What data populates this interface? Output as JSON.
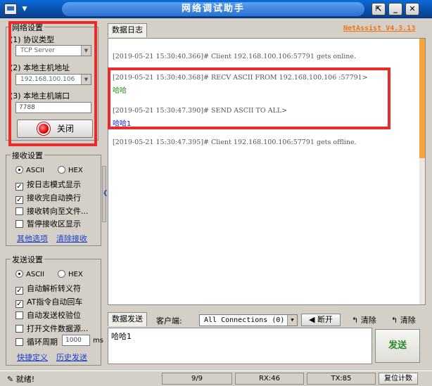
{
  "window": {
    "title": "网络调试助手",
    "brand": "NetAssist V4.3.13"
  },
  "net_settings": {
    "title": "网络设置",
    "protocol_label": "(1) 协议类型",
    "protocol_value": "TCP Server",
    "host_label": "(2) 本地主机地址",
    "host_value": "192.168.100.106",
    "port_label": "(3) 本地主机端口",
    "port_value": "7788",
    "close_label": "关闭"
  },
  "recv_settings": {
    "title": "接收设置",
    "radio_ascii": "ASCII",
    "radio_hex": "HEX",
    "options": [
      "按日志模式显示",
      "接收完自动换行",
      "接收转向至文件...",
      "暂停接收区显示"
    ],
    "checked": [
      true,
      true,
      false,
      false
    ],
    "link_more": "其他选项",
    "link_clear": "清除接收"
  },
  "send_settings": {
    "title": "发送设置",
    "radio_ascii": "ASCII",
    "radio_hex": "HEX",
    "options": [
      "自动解析转义符",
      "AT指令自动回车",
      "自动发送校验位",
      "打开文件数据源..."
    ],
    "checked": [
      true,
      true,
      false,
      false
    ],
    "loop_label": "循环周期",
    "loop_value": "1000",
    "loop_unit": "ms",
    "link_shortcut": "快捷定义",
    "link_history": "历史发送"
  },
  "log": {
    "tab": "数据日志",
    "lines": [
      "[2019-05-21 15:30:40.366]# Client 192.168.100.106:57791 gets online.",
      "[2019-05-21 15:30:40.368]# RECV ASCII FROM 192.168.100.106 :57791>",
      "哈哈",
      "[2019-05-21 15:30:47.390]# SEND ASCII TO ALL>",
      "哈哈1",
      "[2019-05-21 15:30:47.395]# Client 192.168.100.106:57791 gets offline."
    ]
  },
  "send_area": {
    "tab": "数据发送",
    "client_label": "客户端:",
    "client_value": "All Connections (0)",
    "disconnect": "断开",
    "clear1": "清除",
    "clear2": "清除",
    "text": "哈哈1",
    "send_button": "发送"
  },
  "status": {
    "ready": "就绪!",
    "count": "9/9",
    "rx": "RX:46",
    "tx": "TX:85",
    "reset": "复位计数"
  },
  "colors": {
    "highlight": "#ea2b2b",
    "brand": "#f27312",
    "recv_text": "#1a8a1a",
    "send_text": "#1a1acc"
  }
}
